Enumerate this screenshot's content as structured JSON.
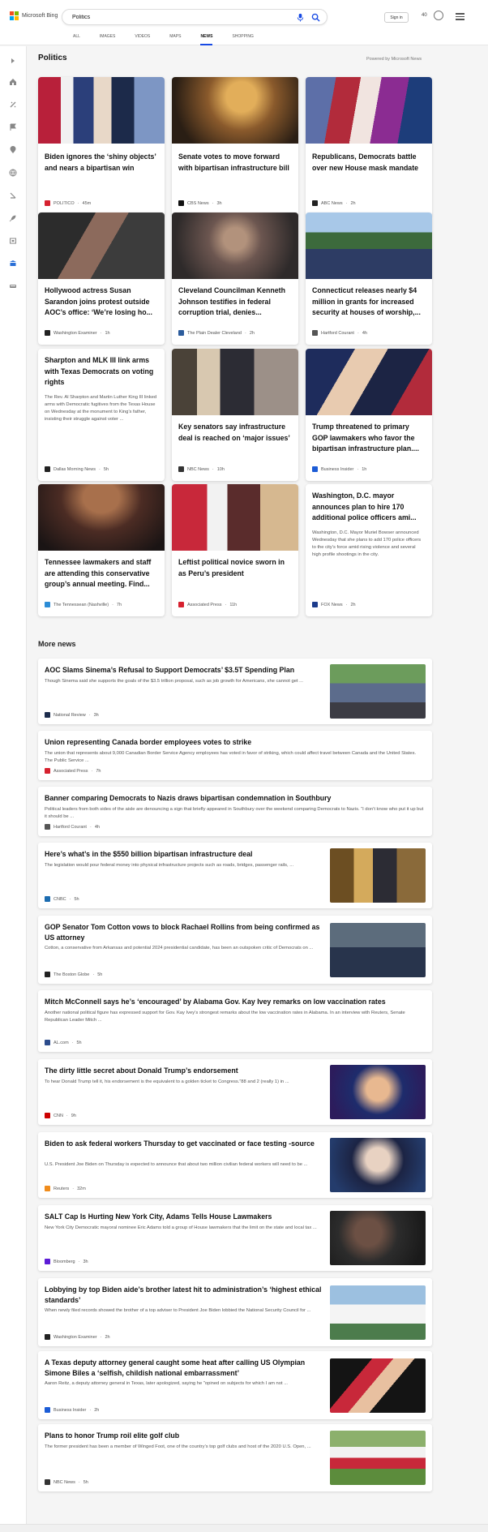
{
  "brand": "Microsoft Bing",
  "search": {
    "value": "Politics"
  },
  "header": {
    "signin": "Sign in",
    "rewards": "40"
  },
  "tabs": [
    "ALL",
    "IMAGES",
    "VIDEOS",
    "MAPS",
    "NEWS",
    "SHOPPING"
  ],
  "active_tab": "NEWS",
  "colors": {
    "accent": "#174ae4",
    "logo": [
      "#f25022",
      "#7fba00",
      "#00a4ef",
      "#ffb900"
    ]
  },
  "section_title": "Politics",
  "powered_by": "Powered by Microsoft News",
  "cards": [
    {
      "title": "Biden ignores the ‘shiny objects’ and nears a bipartisan win",
      "source": "POLITICO",
      "time": "45m",
      "image": "biden-podium-photo"
    },
    {
      "title": "Senate votes to move forward with bipartisan infrastructure bill",
      "source": "CBS News",
      "time": "3h",
      "image": "senators-hallway-photo"
    },
    {
      "title": "Republicans, Democrats battle over new House mask mandate",
      "source": "ABC News",
      "time": "2h",
      "image": "pelosi-flags-photo"
    },
    {
      "title": "Hollywood actress Susan Sarandon joins protest outside AOC’s office: ‘We’re losing ho...",
      "source": "Washington Examiner",
      "time": "1h",
      "image": "sarandon-protest-photo"
    },
    {
      "title": "Cleveland Councilman Kenneth Johnson testifies in federal corruption trial, denies...",
      "source": "The Plain Dealer Cleveland",
      "time": "2h",
      "image": "johnson-court-photo"
    },
    {
      "title": "Connecticut releases nearly $4 million in grants for increased security at houses of worship,...",
      "source": "Hartford Courant",
      "time": "4h",
      "image": "connecticut-outdoor-photo"
    },
    {
      "title": "Sharpton and MLK III link arms with Texas Democrats on voting rights",
      "snippet": "The Rev. Al Sharpton and Martin Luther King III linked arms with Democratic fugitives from the Texas House on Wednesday at the monument to King’s father, insisting their struggle against voter ...",
      "source": "Dallas Morning News",
      "time": "5h"
    },
    {
      "title": "Key senators say infrastructure deal is reached on ‘major issues’",
      "source": "NBC News",
      "time": "10h",
      "image": "senators-talking-photo"
    },
    {
      "title": "Trump threatened to primary GOP lawmakers who favor the bipartisan infrastructure plan....",
      "source": "Business Insider",
      "time": "1h",
      "image": "trump-rally-photo"
    },
    {
      "title": "Tennessee lawmakers and staff are attending this conservative group’s annual meeting. Find...",
      "source": "The Tennessean (Nashville)",
      "time": "7h",
      "image": "conference-hall-photo"
    },
    {
      "title": "Leftist political novice sworn in as Peru’s president",
      "source": "Associated Press",
      "time": "11h",
      "image": "peru-inauguration-photo"
    },
    {
      "title": "Washington, D.C. mayor announces plan to hire 170 additional police officers ami...",
      "snippet": "Washington, D.C. Mayor Muriel Bowser announced Wednesday that she plans to add 170 police officers to the city’s force amid rising violence and several high profile shootings in the city.",
      "source": "FOX News",
      "time": "2h"
    }
  ],
  "more_news_title": "More news",
  "more_news": [
    {
      "title": "AOC Slams Sinema’s Refusal to Support Democrats’ $3.5T Spending Plan",
      "snippet": "Though Sinema said she supports the goals of the $3.5 trillion proposal, such as job growth for Americans, she cannot get ...",
      "source": "National Review",
      "time": "3h",
      "image": "aoc-crowd-photo"
    },
    {
      "title": "Union representing Canada border employees votes to strike",
      "snippet": "The union that represents about 9,000 Canadian Border Service Agency employees has voted in favor of striking, which could affect travel between Canada and the United States. The Public Service ...",
      "source": "Associated Press",
      "time": "7h"
    },
    {
      "title": "Banner comparing Democrats to Nazis draws bipartisan condemnation in Southbury",
      "snippet": "Political leaders from both sides of the aisle are denouncing a sign that briefly appeared in Southbury over the weekend comparing Democrats to Nazis. “I don’t know who put it up but it should be ...",
      "source": "Hartford Courant",
      "time": "4h"
    },
    {
      "title": "Here’s what’s in the $550 billion bipartisan infrastructure deal",
      "snippet": "The legislation would pour federal money into physical infrastructure projects such as roads, bridges, passenger rails, ...",
      "source": "CNBC",
      "time": "5h",
      "image": "oval-office-photo"
    },
    {
      "title": "GOP Senator Tom Cotton vows to block Rachael Rollins from being confirmed as US attorney",
      "snippet": "Cotton, a conservative from Arkansas and potential 2024 presidential candidate, has been an outspoken critic of Democrats on ...",
      "source": "The Boston Globe",
      "time": "5h",
      "image": "cotton-portrait-photo"
    },
    {
      "title": "Mitch McConnell says he’s ‘encouraged’ by Alabama Gov. Kay Ivey remarks on low vaccination rates",
      "snippet": "Another national political figure has expressed support for Gov. Kay Ivey’s strongest remarks about the low vaccination rates in Alabama. In an interview with Reuters, Senate Republican Leader Mitch ...",
      "source": "AL.com",
      "time": "5h"
    },
    {
      "title": "The dirty little secret about Donald Trump’s endorsement",
      "snippet": "To hear Donald Trump tell it, his endorsement is the equivalent to a golden ticket to Congress.”88 and 2 (really 1) in ...",
      "source": "CNN",
      "time": "9h",
      "image": "trump-thumbs-photo"
    },
    {
      "title": "Biden to ask federal workers Thursday to get vaccinated or face testing -source",
      "snippet": "U.S. President Joe Biden on Thursday is expected to announce that about two million civilian federal workers will need to be ...",
      "source": "Reuters",
      "time": "32m",
      "image": "biden-portrait-photo"
    },
    {
      "title": "SALT Cap Is Hurting New York City, Adams Tells House Lawmakers",
      "snippet": "New York City Democratic mayoral nominee Eric Adams told a group of House lawmakers that the limit on the state and local tax ...",
      "source": "Bloomberg",
      "time": "3h",
      "image": "adams-portrait-photo"
    },
    {
      "title": "Lobbying by top Biden aide’s brother latest hit to administration’s ‘highest ethical standards’",
      "snippet": "When newly filed records showed the brother of a top adviser to President Joe Biden lobbied the National Security Council for ...",
      "source": "Washington Examiner",
      "time": "2h",
      "image": "white-house-photo"
    },
    {
      "title": "A Texas deputy attorney general caught some heat after calling US Olympian Simone Biles a ‘selfish, childish national embarrassment’",
      "snippet": "Aaron Reitz, a deputy attorney general in Texas, later apologized, saying he \"opined on subjects for which I am not ...",
      "source": "Business Insider",
      "time": "2h",
      "image": "gymnast-photo"
    },
    {
      "title": "Plans to honor Trump roil elite golf club",
      "snippet": "The former president has been a member of Winged Foot, one of the country’s top golf clubs and host of the 2020 U.S. Open, ...",
      "source": "NBC News",
      "time": "5h",
      "image": "trump-golf-photo"
    }
  ]
}
